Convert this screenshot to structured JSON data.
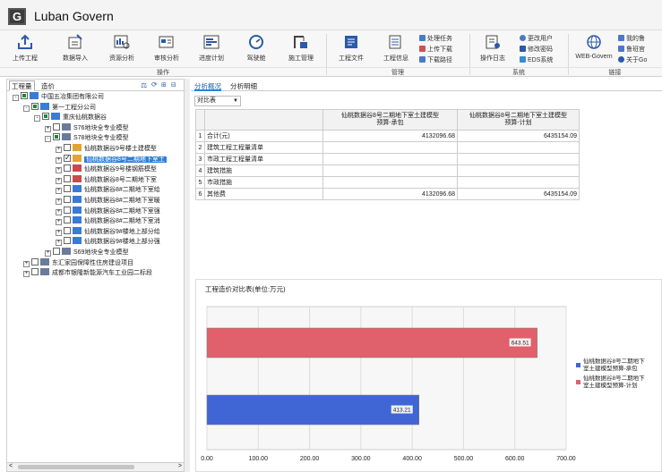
{
  "app": {
    "logo": "G",
    "title": "Luban Govern"
  },
  "ribbon": {
    "operate_buttons": [
      {
        "label": "上传工程",
        "icon": "upload-icon"
      },
      {
        "label": "数据导入",
        "icon": "import-icon"
      },
      {
        "label": "资源分析",
        "icon": "resource-analysis-icon"
      },
      {
        "label": "审核分析",
        "icon": "audit-analysis-icon"
      },
      {
        "label": "进度计划",
        "icon": "schedule-icon"
      },
      {
        "label": "驾驶舱",
        "icon": "dashboard-icon"
      },
      {
        "label": "施工管理",
        "icon": "construction-icon"
      }
    ],
    "operate_group": "操作",
    "manage_buttons": [
      {
        "label": "工程文件",
        "icon": "project-file-icon"
      },
      {
        "label": "工程信息",
        "icon": "project-info-icon"
      }
    ],
    "manage_small": [
      "处理任务",
      "上传下载",
      "下载路径"
    ],
    "manage_group": "管理",
    "system_button": {
      "label": "操作日志",
      "icon": "log-icon"
    },
    "system_small": [
      "更改用户",
      "修改密码",
      "EDS系统"
    ],
    "system_group": "系统",
    "link_button": {
      "label": "WEB-Govern",
      "icon": "globe-icon"
    },
    "link_small": [
      "我的鲁",
      "鲁班官",
      "关于Go"
    ],
    "link_group": "链接"
  },
  "left": {
    "tabs": [
      "工程量",
      "造价"
    ],
    "tree": [
      {
        "label": "中国五冶集团有限公司",
        "level": 0,
        "exp": "-",
        "chk": "part",
        "icon": "company"
      },
      {
        "label": "第一工程分公司",
        "level": 1,
        "exp": "-",
        "chk": "part",
        "icon": "company"
      },
      {
        "label": "重庆仙桃数据谷",
        "level": 2,
        "exp": "-",
        "chk": "part",
        "icon": "company"
      },
      {
        "label": "S76地块全专业模型",
        "level": 3,
        "exp": "+",
        "chk": "none",
        "icon": "model"
      },
      {
        "label": "S78地块全专业模型",
        "level": 3,
        "exp": "-",
        "chk": "part",
        "icon": "model"
      },
      {
        "label": "仙桃数据谷9号楼土建模型",
        "level": 4,
        "exp": "+",
        "chk": "none",
        "icon": "folder"
      },
      {
        "label": "仙桃数据谷8号二期地下室土",
        "level": 4,
        "exp": "+",
        "chk": "on",
        "icon": "folder",
        "selected": true
      },
      {
        "label": "仙桃数据谷9号楼钢筋模型",
        "level": 4,
        "exp": "+",
        "chk": "none",
        "icon": "rebar"
      },
      {
        "label": "仙桃数据谷8号二期地下室",
        "level": 4,
        "exp": "+",
        "chk": "none",
        "icon": "rebar"
      },
      {
        "label": "仙桃数据谷8#二期地下室给",
        "level": 4,
        "exp": "+",
        "chk": "none",
        "icon": "mep"
      },
      {
        "label": "仙桃数据谷8#二期地下室暖",
        "level": 4,
        "exp": "+",
        "chk": "none",
        "icon": "mep"
      },
      {
        "label": "仙桃数据谷8#二期地下室强",
        "level": 4,
        "exp": "+",
        "chk": "none",
        "icon": "mep"
      },
      {
        "label": "仙桃数据谷8#二期地下室消",
        "level": 4,
        "exp": "+",
        "chk": "none",
        "icon": "mep"
      },
      {
        "label": "仙桃数据谷9#楼地上部分给",
        "level": 4,
        "exp": "+",
        "chk": "none",
        "icon": "mep"
      },
      {
        "label": "仙桃数据谷9#楼地上部分强",
        "level": 4,
        "exp": "+",
        "chk": "none",
        "icon": "mep"
      },
      {
        "label": "S69地块全专业模型",
        "level": 3,
        "exp": "+",
        "chk": "none",
        "icon": "model"
      },
      {
        "label": "东汇家园保障性住房建设项目",
        "level": 1,
        "exp": "+",
        "chk": "none",
        "icon": "model"
      },
      {
        "label": "成都市银隆新能源汽车工业园二标段",
        "level": 1,
        "exp": "+",
        "chk": "none",
        "icon": "model"
      }
    ]
  },
  "right": {
    "tabs": [
      "分析概况",
      "分析明细"
    ],
    "combo": "对比表",
    "table": {
      "headers": [
        "",
        "",
        "仙桃数据谷8号二期地下室土建模型\n预算-承包",
        "仙桃数据谷8号二期地下室土建模型\n预算-计划"
      ],
      "rows": [
        [
          "1",
          "合计(元)",
          "4132096.68",
          "6435154.09"
        ],
        [
          "2",
          "建筑工程工程量清单",
          "",
          ""
        ],
        [
          "3",
          "市政工程工程量清单",
          "",
          ""
        ],
        [
          "4",
          "建筑措施",
          "",
          ""
        ],
        [
          "5",
          "市政措施",
          "",
          ""
        ],
        [
          "6",
          "其他费",
          "4132096.68",
          "6435154.09"
        ]
      ]
    }
  },
  "chart_data": {
    "type": "bar",
    "orientation": "horizontal",
    "title": "工程造价对比表(单位:万元)",
    "series": [
      {
        "name": "仙桃数据谷8号二期地下室土建模型预算-计划",
        "values": [
          643.51
        ],
        "color": "#e0606b"
      },
      {
        "name": "仙桃数据谷8号二期地下室土建模型预算-承包",
        "values": [
          413.21
        ],
        "color": "#3f66d4"
      }
    ],
    "data_labels": [
      "643.51",
      "413.21"
    ],
    "xlim": [
      0,
      700
    ],
    "xticks": [
      "0.00",
      "100.00",
      "200.00",
      "300.00",
      "400.00",
      "500.00",
      "600.00",
      "700.00"
    ],
    "grid": true,
    "legend": {
      "placement": "right",
      "entries": [
        "仙桃数据谷8号二期地下室土建模型预算-承包",
        "仙桃数据谷8号二期地下室土建模型预算-计划"
      ]
    }
  }
}
